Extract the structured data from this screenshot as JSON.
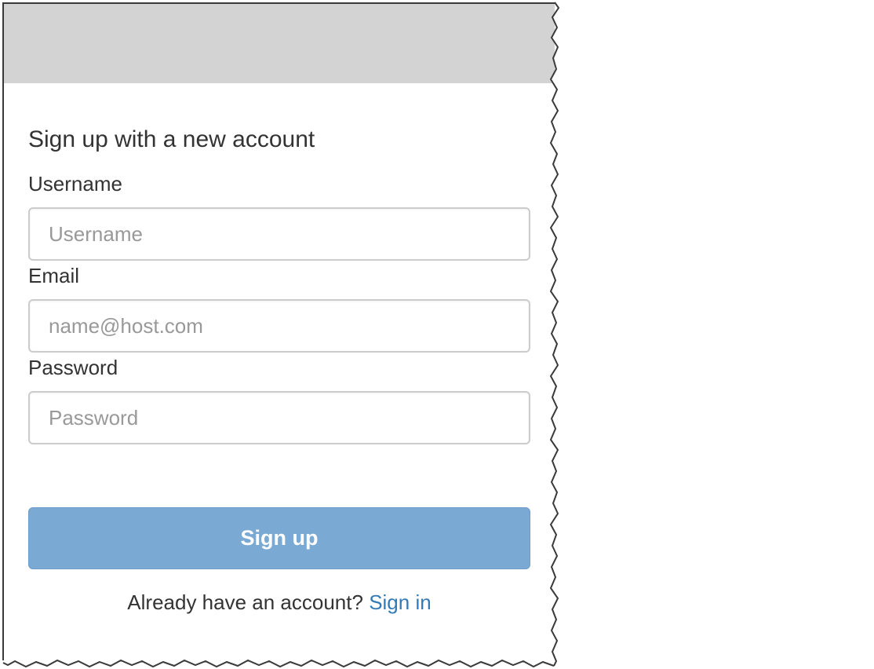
{
  "form": {
    "title": "Sign up with a new account",
    "fields": {
      "username": {
        "label": "Username",
        "placeholder": "Username"
      },
      "email": {
        "label": "Email",
        "placeholder": "name@host.com"
      },
      "password": {
        "label": "Password",
        "placeholder": "Password"
      }
    },
    "submit_label": "Sign up",
    "footer": {
      "prompt": "Already have an account?",
      "link_label": "Sign in"
    }
  },
  "colors": {
    "header_bar": "#d3d3d3",
    "button": "#7aaad3",
    "link": "#337ab7"
  }
}
